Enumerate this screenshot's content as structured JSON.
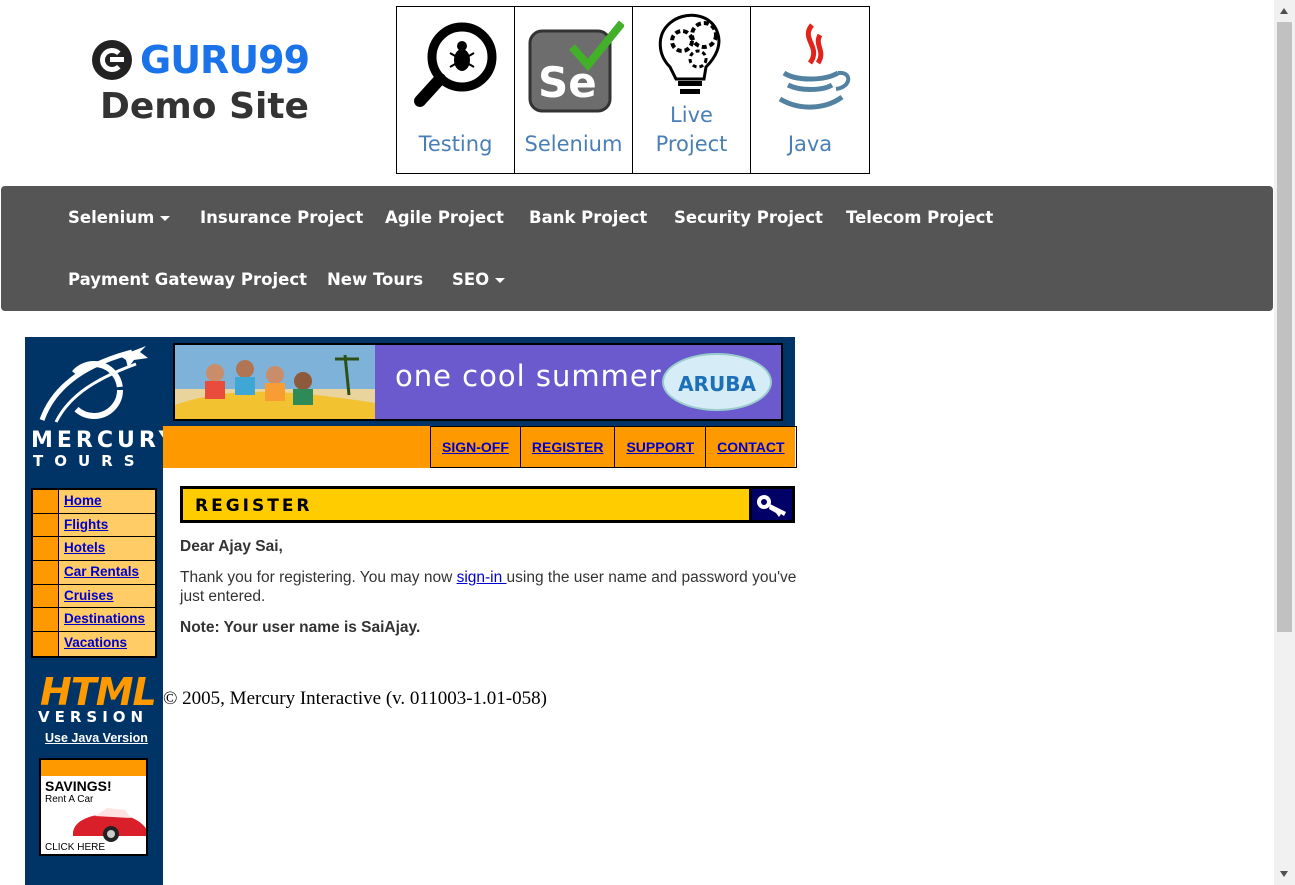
{
  "logo": {
    "brand": "GURU99",
    "subtitle": "Demo Site"
  },
  "tiles": [
    {
      "label": "Testing",
      "icon": "bug-magnifier-icon"
    },
    {
      "label": "Selenium",
      "icon": "selenium-icon"
    },
    {
      "label": "Live Project",
      "label_line1": "Live",
      "label_line2": "Project",
      "icon": "bulb-gears-icon"
    },
    {
      "label": "Java",
      "icon": "java-icon"
    }
  ],
  "nav": {
    "row1": [
      "Selenium",
      "Insurance Project",
      "Agile Project",
      "Bank Project",
      "Security Project",
      "Telecom Project"
    ],
    "row2": [
      "Payment Gateway Project",
      "New Tours",
      "SEO"
    ]
  },
  "mercury": {
    "logo_top": "MERCURY",
    "logo_bottom": "TOURS",
    "banner_text": "one cool summer",
    "banner_badge": "ARUBA",
    "top_links": [
      "SIGN-OFF",
      "REGISTER",
      "SUPPORT",
      "CONTACT"
    ],
    "side_menu": [
      "Home",
      "Flights",
      "Hotels",
      "Car Rentals",
      "Cruises",
      "Destinations",
      "Vacations"
    ],
    "html_version_big": "HTML",
    "html_version_small": "VERSION",
    "java_link": "Use Java Version",
    "savings_title": "SAVINGS!",
    "savings_sub": "Rent A Car",
    "savings_click": "CLICK HERE",
    "register_heading": "REGISTER",
    "greeting": "Dear Ajay Sai,",
    "thanks_before": "Thank you for registering. You may now ",
    "signin_link": "sign-in ",
    "thanks_after": "using the user name and password you've just entered.",
    "note": "Note: Your user name is SaiAjay.",
    "copyright": "© 2005, Mercury Interactive (v. 011003-1.01-058)"
  },
  "colors": {
    "navbar": "#555555",
    "brand_blue": "#1a73e8",
    "mercury_navy": "#003366",
    "mercury_orange": "#ff9900",
    "register_yellow": "#ffcc00",
    "link_blue": "#0000cc"
  }
}
